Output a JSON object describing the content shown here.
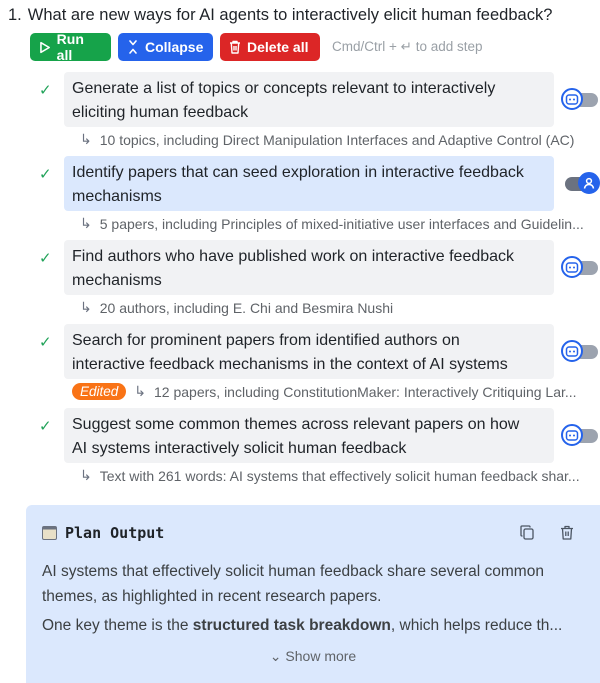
{
  "question": {
    "number": "1.",
    "text": "What are new ways for AI agents to interactively elicit human feedback?"
  },
  "toolbar": {
    "run_all": "Run all",
    "collapse": "Collapse",
    "delete_all": "Delete all",
    "hint": "Cmd/Ctrl + ↵ to add step"
  },
  "steps": [
    {
      "line1": "Generate a list of topics or concepts relevant to interactively",
      "line2": "eliciting human feedback",
      "result": "10 topics, including Direct Manipulation Interfaces and Adaptive Control (AC)",
      "mode": "agent"
    },
    {
      "line1": "Identify papers that can seed exploration in interactive feedback",
      "line2": "mechanisms",
      "result": "5 papers, including Principles of mixed-initiative user interfaces and Guidelin...",
      "mode": "human"
    },
    {
      "line1": "Find authors who have published work on interactive feedback",
      "line2": "mechanisms",
      "result": "20 authors, including E. Chi and Besmira Nushi",
      "mode": "agent"
    },
    {
      "line1": "Search for prominent papers from identified authors on",
      "line2": "interactive feedback mechanisms in the context of AI systems",
      "result": "12 papers, including ConstitutionMaker: Interactively Critiquing Lar...",
      "badge": "Edited",
      "mode": "agent"
    },
    {
      "line1": "Suggest some common themes across relevant papers on how",
      "line2": "AI systems interactively solicit human feedback",
      "result": "Text with 261 words: AI systems that effectively solicit human feedback shar...",
      "mode": "agent"
    }
  ],
  "output": {
    "title": "Plan Output",
    "para1": "AI systems that effectively solicit human feedback share several common themes, as highlighted in recent research papers.",
    "para2_prefix": "One key theme is the ",
    "para2_bold": "structured task breakdown",
    "para2_suffix": ", which helps reduce th...",
    "show_more": "Show more"
  },
  "colors": {
    "run": "#16a34a",
    "collapse": "#2563eb",
    "delete": "#dc2626",
    "edited": "#f97316",
    "active_card": "#dbe8fd"
  }
}
